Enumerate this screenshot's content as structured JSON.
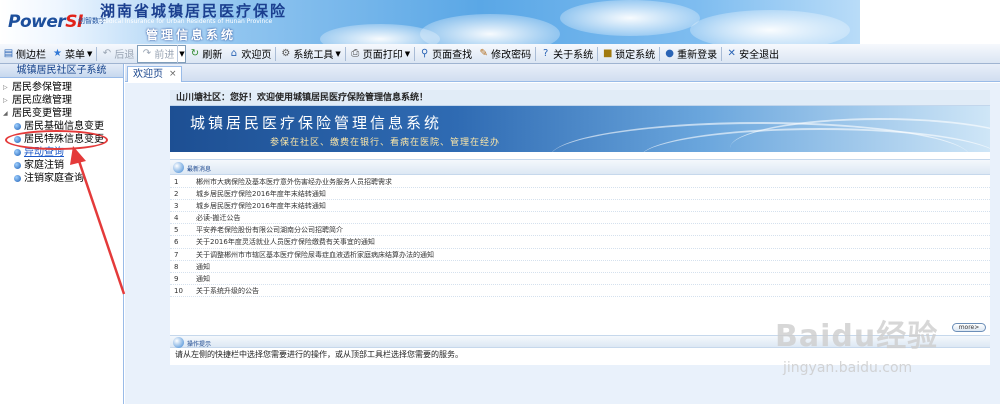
{
  "header": {
    "logo_main": "Power",
    "logo_accent": "SI",
    "logo_cn": "创智数字",
    "title": "湖南省城镇居民医疗保险",
    "title_en": "Medical Insurance for Urban Residents of Hunan Province",
    "subtitle": "管理信息系统"
  },
  "toolbar": {
    "items": [
      {
        "label": "侧边栏",
        "icon": "sidebar-icon"
      },
      {
        "label": "菜单",
        "icon": "star-icon",
        "dropdown": true
      },
      {
        "label": "后退",
        "icon": "back-icon",
        "disabled": true
      },
      {
        "label": "前进",
        "icon": "forward-icon",
        "disabled": true
      },
      {
        "label": "刷新",
        "icon": "refresh-icon"
      },
      {
        "label": "欢迎页",
        "icon": "home-icon"
      },
      {
        "label": "系统工具",
        "icon": "gear-icon",
        "dropdown": true
      },
      {
        "label": "页面打印",
        "icon": "print-icon",
        "dropdown": true
      },
      {
        "label": "页面查找",
        "icon": "search-icon"
      },
      {
        "label": "修改密码",
        "icon": "pencil-icon"
      },
      {
        "label": "关于系统",
        "icon": "help-icon"
      },
      {
        "label": "锁定系统",
        "icon": "lock-icon"
      },
      {
        "label": "重新登录",
        "icon": "relogin-icon"
      },
      {
        "label": "安全退出",
        "icon": "exit-icon"
      }
    ]
  },
  "sidebar": {
    "title": "城镇居民社区子系统",
    "groups": [
      {
        "label": "居民参保管理",
        "expanded": false
      },
      {
        "label": "居民应缴管理",
        "expanded": false
      },
      {
        "label": "居民变更管理",
        "expanded": true
      }
    ],
    "items": [
      {
        "label": "居民基础信息变更"
      },
      {
        "label": "居民特殊信息变更"
      },
      {
        "label": "异动查询"
      },
      {
        "label": "家庭注销"
      },
      {
        "label": "注销家庭查询"
      }
    ]
  },
  "tabs": [
    {
      "label": "欢迎页",
      "close": "×"
    }
  ],
  "welcome": {
    "greeting": "山川塘社区：您好！欢迎使用城镇居民医疗保险管理信息系统！",
    "hero_title": "城镇居民医疗保险管理信息系统",
    "hero_sub": "参保在社区、缴费在银行、看病在医院、管理在经办",
    "news_header": "最新消息",
    "news": [
      {
        "num": "1",
        "title": "郴州市大病保险及基本医疗意外伤害经办业务服务人员招聘需求"
      },
      {
        "num": "2",
        "title": "城乡居民医疗保险2016年度年末结转通知"
      },
      {
        "num": "3",
        "title": "城乡居民医疗保险2016年度年末结转通知"
      },
      {
        "num": "4",
        "title": "必读-搬迁公告"
      },
      {
        "num": "5",
        "title": "平安养老保险股份有限公司湖南分公司招聘简介"
      },
      {
        "num": "6",
        "title": "关于2016年度灵活就业人员医疗保险缴费有关事宜的通知"
      },
      {
        "num": "7",
        "title": "关于调整郴州市市辖区基本医疗保险尿毒症血液透析家庭病床结算办法的通知"
      },
      {
        "num": "8",
        "title": "通知"
      },
      {
        "num": "9",
        "title": "通知"
      },
      {
        "num": "10",
        "title": "关于系统升级的公告"
      }
    ],
    "more_label": "more>",
    "ops_header": "操作提示",
    "ops_text": "请从左侧的快捷栏中选择您需要进行的操作，或从顶部工具栏选择您需要的服务。"
  },
  "watermark": {
    "brand": "Baidu经验",
    "url": "jingyan.baidu.com"
  },
  "colors": {
    "accent": "#15428b",
    "annotation": "#e43a3a"
  }
}
